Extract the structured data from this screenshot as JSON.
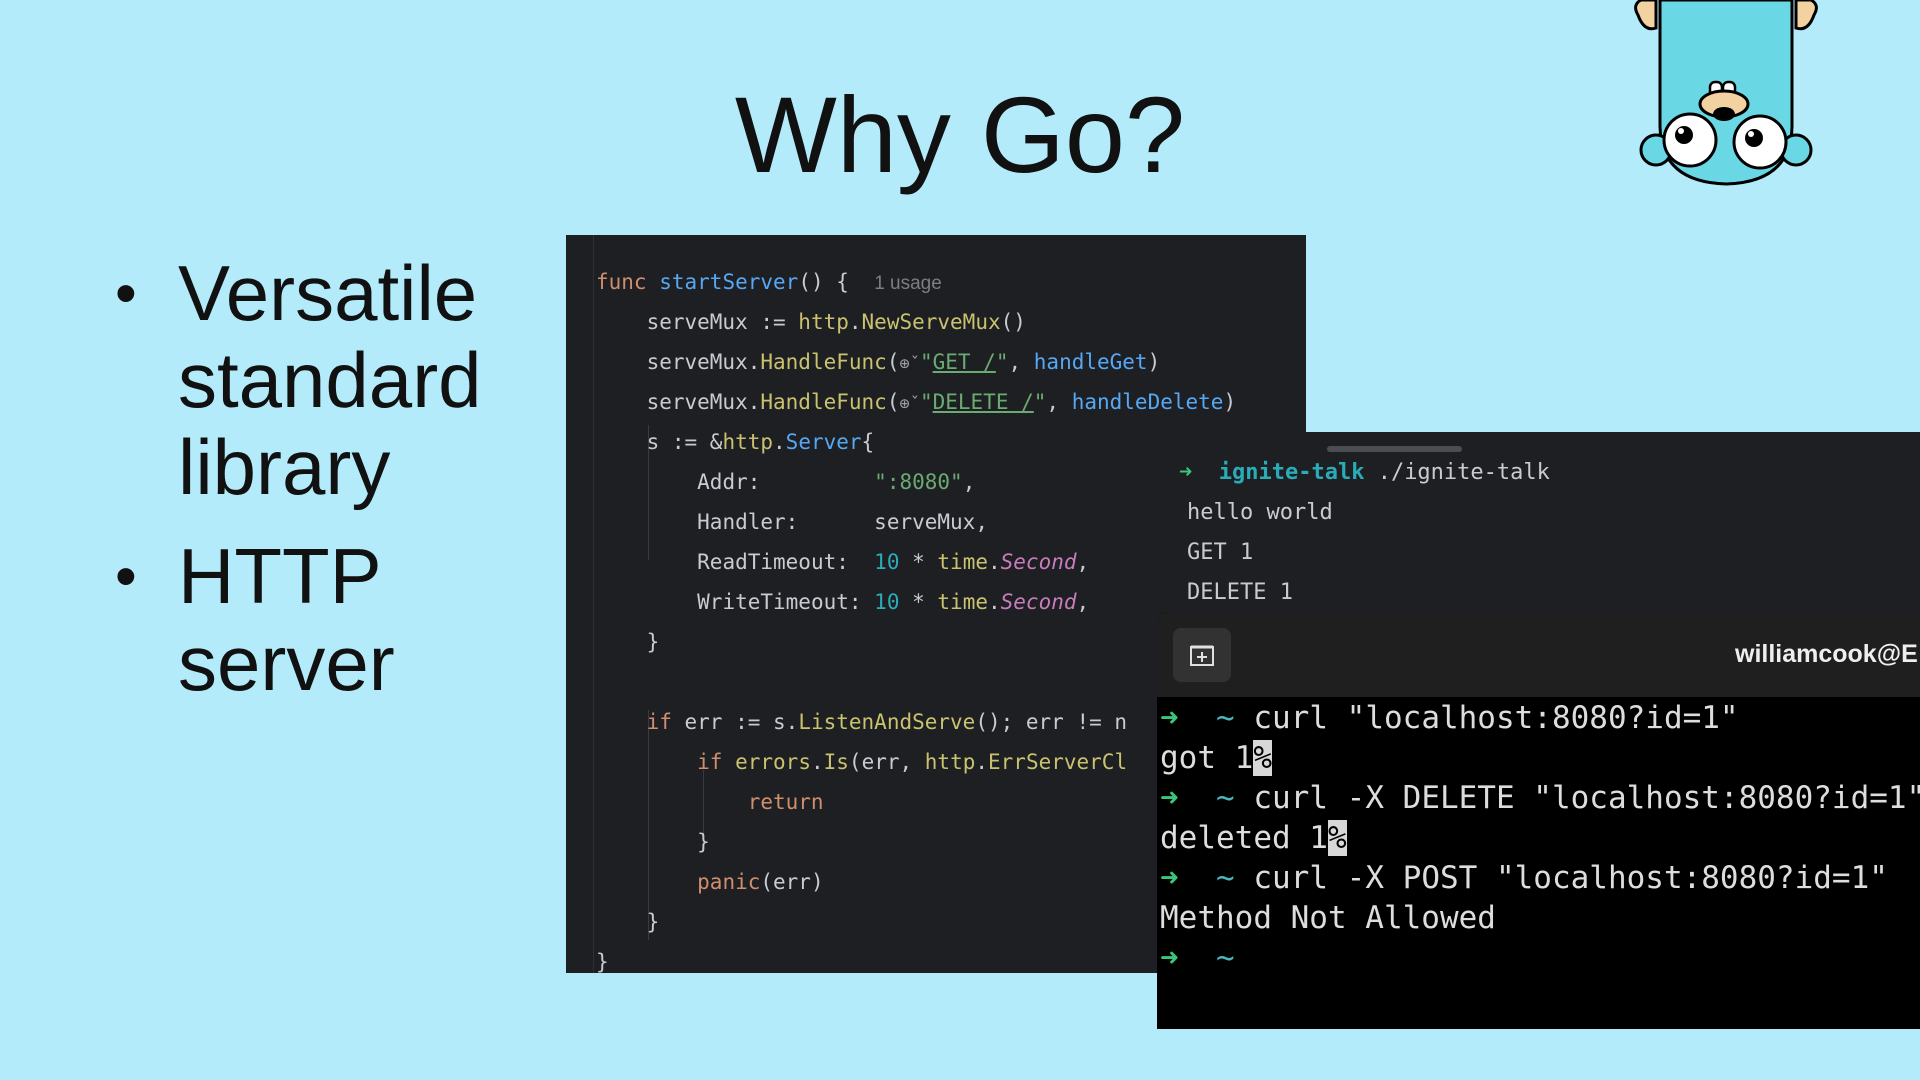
{
  "slide": {
    "title": "Why Go?",
    "bullets": [
      "Versatile standard library",
      "HTTP server"
    ]
  },
  "code": {
    "l1": {
      "kw": "func",
      "fn": "startServer",
      "rest": "() {",
      "hint": "1 usage"
    },
    "l2": {
      "a": "serveMux := ",
      "b": "http",
      "c": ".",
      "d": "NewServeMux",
      "e": "()"
    },
    "l3": {
      "a": "serveMux.",
      "b": "HandleFunc",
      "c": "(",
      "d": "\"",
      "e": "GET /",
      "f": "\"",
      "g": ", ",
      "h": "handleGet",
      "i": ")"
    },
    "l4": {
      "a": "serveMux.",
      "b": "HandleFunc",
      "c": "(",
      "d": "\"",
      "e": "DELETE /",
      "f": "\"",
      "g": ", ",
      "h": "handleDelete",
      "i": ")"
    },
    "l5": {
      "a": "s := &",
      "b": "http",
      "c": ".",
      "d": "Server",
      "e": "{"
    },
    "l6": {
      "a": "Addr:         ",
      "b": "\":8080\"",
      "c": ","
    },
    "l7": {
      "a": "Handler:      ",
      "b": "serveMux",
      "c": ","
    },
    "l8": {
      "a": "ReadTimeout:  ",
      "b": "10",
      "c": " * ",
      "d": "time",
      "e": ".",
      "f": "Second",
      "g": ","
    },
    "l9": {
      "a": "WriteTimeout: ",
      "b": "10",
      "c": " * ",
      "d": "time",
      "e": ".",
      "f": "Second",
      "g": ","
    },
    "l10": "}",
    "l11": {
      "kw": "if",
      "a": " err := s.",
      "b": "ListenAndServe",
      "c": "(); err != n"
    },
    "l12": {
      "kw": "if",
      "a": " ",
      "b": "errors",
      "c": ".",
      "d": "Is",
      "e": "(err, ",
      "f": "http",
      "g": ".",
      "h": "ErrServerCl"
    },
    "l13": "return",
    "l14": "}",
    "l15": {
      "kw": "panic",
      "rest": "(err)"
    },
    "l16": "}",
    "l17": "}"
  },
  "terminal_top": {
    "prompt_arrow": "➜",
    "dir": "ignite-talk",
    "command": " ./ignite-talk",
    "out1": "hello world",
    "out2": "GET 1",
    "out3": "DELETE 1"
  },
  "terminal_bottom": {
    "host": "williamcook@E",
    "arrow": "➜",
    "tilde": "~",
    "cmd1": "curl \"localhost:8080?id=1\"",
    "out1": "got 1",
    "cmd2": "curl -X DELETE \"localhost:8080?id=1\"",
    "out2": "deleted 1",
    "cmd3": "curl -X POST \"localhost:8080?id=1\"",
    "out3": "Method Not Allowed",
    "pct": "%"
  },
  "colors": {
    "background": "#b3ebfb",
    "editor_bg": "#1e1f22",
    "terminal_bg": "#000000",
    "prompt_green": "#39c67a"
  }
}
